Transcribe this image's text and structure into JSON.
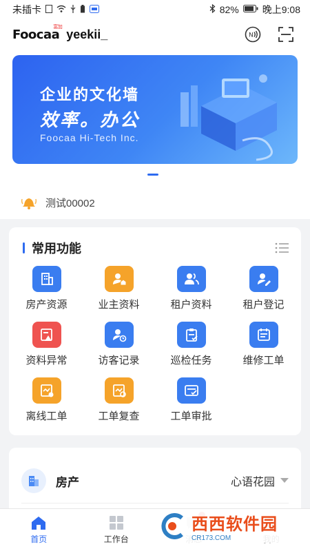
{
  "status_bar": {
    "carrier": "未插卡",
    "battery": "82%",
    "time": "晚上9:08"
  },
  "header": {
    "logo_text": "Foocaa",
    "logo_tag": "富加",
    "username": "yeekii_"
  },
  "banner": {
    "title": "企业的文化墙",
    "slogan": "效率。办公",
    "company": "Foocaa Hi-Tech Inc."
  },
  "notice": {
    "text": "测试00002"
  },
  "functions": {
    "title": "常用功能",
    "items": [
      {
        "label": "房产资源",
        "icon": "building-icon",
        "color": "#3a7df0"
      },
      {
        "label": "业主资料",
        "icon": "owner-icon",
        "color": "#f5a32a"
      },
      {
        "label": "租户资料",
        "icon": "tenants-icon",
        "color": "#3a7df0"
      },
      {
        "label": "租户登记",
        "icon": "tenant-register-icon",
        "color": "#3a7df0"
      },
      {
        "label": "资料异常",
        "icon": "data-error-icon",
        "color": "#ef5350"
      },
      {
        "label": "访客记录",
        "icon": "visitor-record-icon",
        "color": "#3a7df0"
      },
      {
        "label": "巡检任务",
        "icon": "inspection-icon",
        "color": "#3a7df0"
      },
      {
        "label": "维修工单",
        "icon": "repair-order-icon",
        "color": "#3a7df0"
      },
      {
        "label": "离线工单",
        "icon": "offline-order-icon",
        "color": "#f5a32a"
      },
      {
        "label": "工单复查",
        "icon": "order-review-icon",
        "color": "#f5a32a"
      },
      {
        "label": "工单审批",
        "icon": "order-approval-icon",
        "color": "#3a7df0"
      }
    ]
  },
  "property": {
    "label": "房产",
    "value": "心语花园"
  },
  "bottom_nav": {
    "items": [
      {
        "label": "首页",
        "icon": "home-icon",
        "active": true
      },
      {
        "label": "工作台",
        "icon": "workbench-icon",
        "active": false
      },
      {
        "label": "消息",
        "icon": "message-icon",
        "active": false
      },
      {
        "label": "我的",
        "icon": "profile-icon",
        "active": false
      }
    ]
  },
  "watermark": {
    "main": "西西软件园",
    "sub": "CR173.COM"
  },
  "colors": {
    "primary": "#2e6bf0",
    "orange": "#f5a32a",
    "red": "#ef5350"
  }
}
